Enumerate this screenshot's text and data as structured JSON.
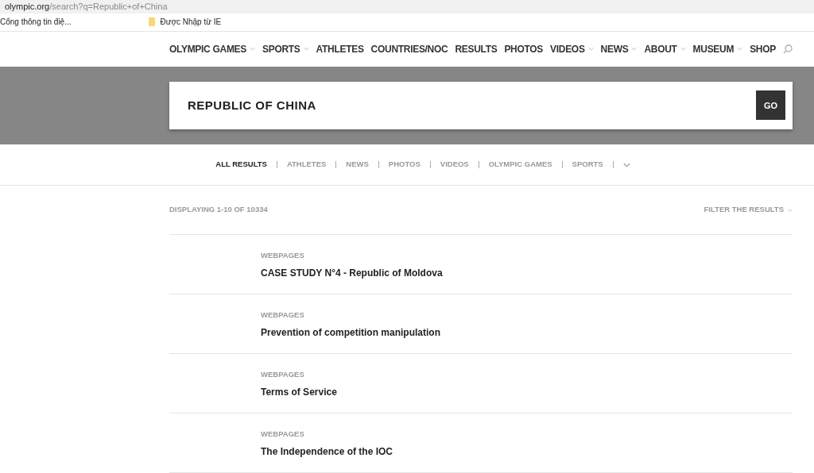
{
  "address_bar": {
    "domain": "olympic.org",
    "path": "/search?q=Republic+of+China"
  },
  "bookmarks": [
    {
      "label": "Cổng thông tin điệ...",
      "kind": "page"
    },
    {
      "label": "Được Nhập từ IE",
      "kind": "folder"
    }
  ],
  "nav": {
    "items": [
      {
        "label": "OLYMPIC GAMES",
        "dropdown": true
      },
      {
        "label": "SPORTS",
        "dropdown": true
      },
      {
        "label": "ATHLETES",
        "dropdown": false
      },
      {
        "label": "COUNTRIES/NOC",
        "dropdown": false
      },
      {
        "label": "RESULTS",
        "dropdown": false
      },
      {
        "label": "PHOTOS",
        "dropdown": false
      },
      {
        "label": "VIDEOS",
        "dropdown": true
      },
      {
        "label": "NEWS",
        "dropdown": true
      },
      {
        "label": "ABOUT",
        "dropdown": true
      },
      {
        "label": "MUSEUM",
        "dropdown": true
      },
      {
        "label": "SHOP",
        "dropdown": false
      }
    ]
  },
  "search": {
    "value": "REPUBLIC OF CHINA",
    "button": "GO"
  },
  "filter_tabs": [
    {
      "label": "ALL RESULTS",
      "selected": true
    },
    {
      "label": "ATHLETES",
      "selected": false
    },
    {
      "label": "NEWS",
      "selected": false
    },
    {
      "label": "PHOTOS",
      "selected": false
    },
    {
      "label": "VIDEOS",
      "selected": false
    },
    {
      "label": "OLYMPIC GAMES",
      "selected": false
    },
    {
      "label": "SPORTS",
      "selected": false
    }
  ],
  "results_summary": "DISPLAYING 1-10 OF 10334",
  "filter_label": "FILTER THE RESULTS",
  "results": [
    {
      "category": "WEBPAGES",
      "title": "CASE STUDY N°4 - Republic of Moldova"
    },
    {
      "category": "WEBPAGES",
      "title": "Prevention of competition manipulation"
    },
    {
      "category": "WEBPAGES",
      "title": "Terms of Service"
    },
    {
      "category": "WEBPAGES",
      "title": "The Independence of the IOC"
    }
  ]
}
